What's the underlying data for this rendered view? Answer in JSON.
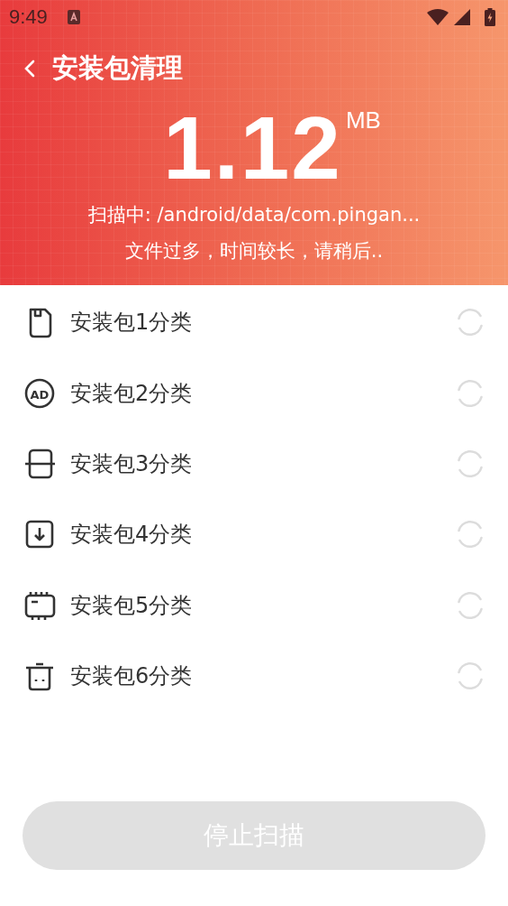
{
  "status_bar": {
    "time": "9:49"
  },
  "header": {
    "title": "安装包清理",
    "size": "1.12",
    "unit": "MB",
    "scan_path": "扫描中: /android/data/com.pingan...",
    "hint": "文件过多，时间较长，请稍后.."
  },
  "categories": [
    {
      "label": "安装包1分类"
    },
    {
      "label": "安装包2分类",
      "icon_label": "AD"
    },
    {
      "label": "安装包3分类"
    },
    {
      "label": "安装包4分类"
    },
    {
      "label": "安装包5分类"
    },
    {
      "label": "安装包6分类"
    }
  ],
  "stop_button": {
    "label": "停止扫描",
    "disabled": true
  }
}
